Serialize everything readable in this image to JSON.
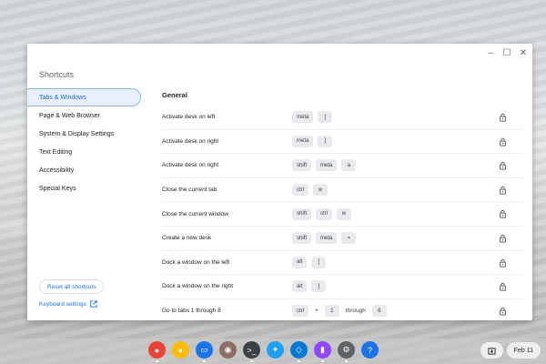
{
  "app": {
    "title": "Shortcuts"
  },
  "window_controls": {
    "minimize": "–",
    "maximize": "☐",
    "close": "✕"
  },
  "sidebar": {
    "items": [
      {
        "label": "Tabs & Windows"
      },
      {
        "label": "Page & Web Browser"
      },
      {
        "label": "System & Display Settings"
      },
      {
        "label": "Text Editing"
      },
      {
        "label": "Accessibility"
      },
      {
        "label": "Special Keys"
      }
    ],
    "reset_label": "Reset all shortcuts",
    "keyboard_settings_label": "Keyboard settings"
  },
  "main": {
    "section_title": "General",
    "rows": [
      {
        "desc": "Activate desk on left",
        "keys": [
          "meta",
          "["
        ]
      },
      {
        "desc": "Activate desk on right",
        "keys": [
          "meta",
          "]"
        ]
      },
      {
        "desc": "Activate desk on right",
        "keys": [
          "shift",
          "meta",
          "a"
        ]
      },
      {
        "desc": "Close the current tab",
        "keys": [
          "ctrl",
          "w"
        ]
      },
      {
        "desc": "Close the current window",
        "keys": [
          "shift",
          "ctrl",
          "w"
        ]
      },
      {
        "desc": "Create a new desk",
        "keys": [
          "shift",
          "meta",
          "="
        ]
      },
      {
        "desc": "Dock a window on the left",
        "keys": [
          "alt",
          "["
        ]
      },
      {
        "desc": "Dock a window on the right",
        "keys": [
          "alt",
          "]"
        ]
      },
      {
        "desc": "Go to tabs 1 through 8",
        "keys": [
          "ctrl",
          "+",
          "1",
          "through",
          "8"
        ]
      }
    ]
  },
  "shelf": {
    "apps": [
      {
        "name": "chrome-icon",
        "color": "#ea4335"
      },
      {
        "name": "canary-icon",
        "color": "#fbbc04"
      },
      {
        "name": "files-icon",
        "color": "#1a73e8"
      },
      {
        "name": "photos-icon",
        "color": "#8d6e63"
      },
      {
        "name": "terminal-icon",
        "color": "#3c4043"
      },
      {
        "name": "twitter-icon",
        "color": "#1da1f2"
      },
      {
        "name": "vscode-icon",
        "color": "#0078d4"
      },
      {
        "name": "twitch-icon",
        "color": "#9146ff"
      },
      {
        "name": "settings-icon",
        "color": "#5f6368"
      },
      {
        "name": "help-icon",
        "color": "#1a73e8"
      }
    ],
    "date": "Feb 11"
  }
}
